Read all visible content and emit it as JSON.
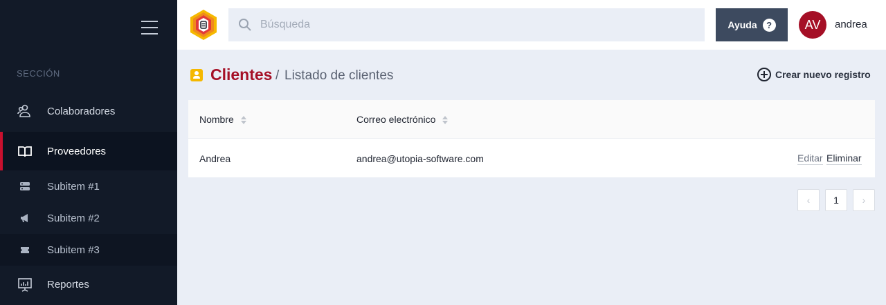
{
  "sidebar": {
    "section_label": "SECCIÓN",
    "items": [
      {
        "label": "Colaboradores",
        "icon": "users-icon"
      },
      {
        "label": "Proveedores",
        "icon": "book-icon",
        "active": true
      },
      {
        "label": "Subitem #1",
        "icon": "server-icon"
      },
      {
        "label": "Subitem #2",
        "icon": "megaphone-icon"
      },
      {
        "label": "Subitem #3",
        "icon": "ticket-icon"
      },
      {
        "label": "Reportes",
        "icon": "presentation-chart-icon"
      }
    ]
  },
  "topbar": {
    "search_placeholder": "Búsqueda",
    "help_label": "Ayuda",
    "help_icon": "?",
    "avatar_initials": "AV",
    "username": "andrea"
  },
  "page": {
    "title": "Clientes",
    "separator": "/",
    "breadcrumb": "Listado de clientes",
    "create_label": "Crear nuevo registro"
  },
  "table": {
    "columns": [
      "Nombre",
      "Correo electrónico"
    ],
    "rows": [
      {
        "nombre": "Andrea",
        "correo": "andrea@utopia-software.com",
        "edit": "Editar",
        "delete": "Eliminar"
      }
    ]
  },
  "pagination": {
    "prev": "‹",
    "current": "1",
    "next": "›"
  },
  "colors": {
    "accent": "#a50f26",
    "sidebar_bg": "#121a28",
    "page_icon": "#f5b800"
  }
}
